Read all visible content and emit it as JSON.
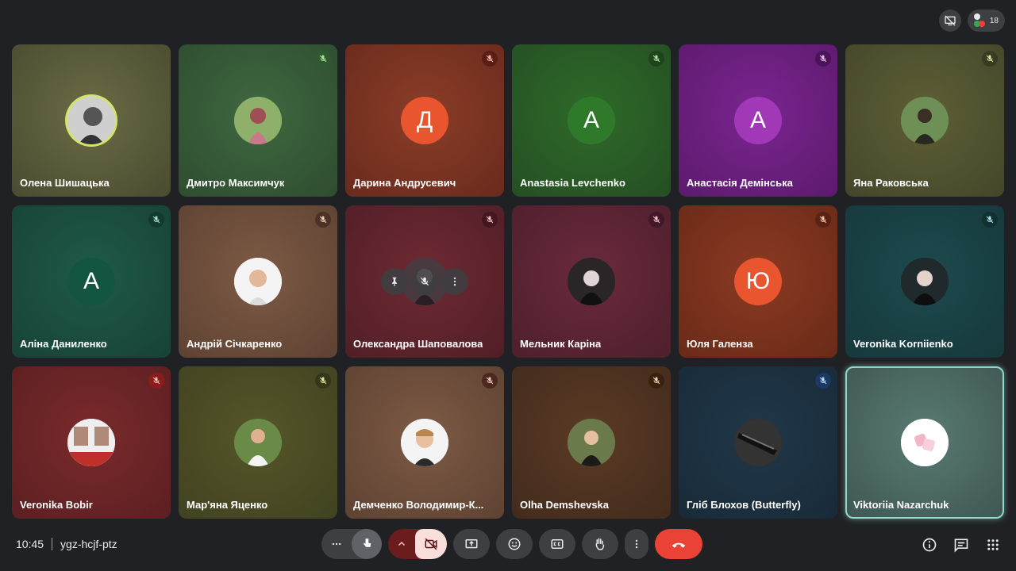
{
  "top_bar": {
    "participant_count": "18"
  },
  "colors": {
    "background": "#202124",
    "hangup": "#ea4335",
    "active_border": "#8ed8c9"
  },
  "tiles": [
    {
      "name": "Олена Шишацька",
      "avatar_letter": "",
      "muted": false
    },
    {
      "name": "Дмитро Максимчук",
      "avatar_letter": "",
      "muted": true
    },
    {
      "name": "Дарина Андрусевич",
      "avatar_letter": "Д",
      "muted": true
    },
    {
      "name": "Anastasia Levchenko",
      "avatar_letter": "A",
      "muted": true
    },
    {
      "name": "Анастасія Демінська",
      "avatar_letter": "A",
      "muted": true
    },
    {
      "name": "Яна Раковська",
      "avatar_letter": "",
      "muted": true
    },
    {
      "name": "Аліна Даниленко",
      "avatar_letter": "A",
      "muted": true
    },
    {
      "name": "Андрій Січкаренко",
      "avatar_letter": "",
      "muted": true
    },
    {
      "name": "Олександра Шаповалова",
      "avatar_letter": "",
      "muted": true
    },
    {
      "name": "Мельник Каріна",
      "avatar_letter": "",
      "muted": true
    },
    {
      "name": "Юля Галенза",
      "avatar_letter": "Ю",
      "muted": true
    },
    {
      "name": "Veronika Korniienko",
      "avatar_letter": "",
      "muted": true
    },
    {
      "name": "Veronika Bobir",
      "avatar_letter": "",
      "muted": true
    },
    {
      "name": "Мар'яна Яценко",
      "avatar_letter": "",
      "muted": true
    },
    {
      "name": "Демченко Володимир-К...",
      "avatar_letter": "",
      "muted": true
    },
    {
      "name": "Olha Demshevska",
      "avatar_letter": "",
      "muted": true
    },
    {
      "name": "Гліб Блохов (Butterfly)",
      "avatar_letter": "",
      "muted": true
    },
    {
      "name": "Viktoriia Nazarchuk",
      "avatar_letter": "",
      "muted": false
    }
  ],
  "meeting": {
    "time": "10:45",
    "code": "ygz-hcjf-ptz"
  }
}
